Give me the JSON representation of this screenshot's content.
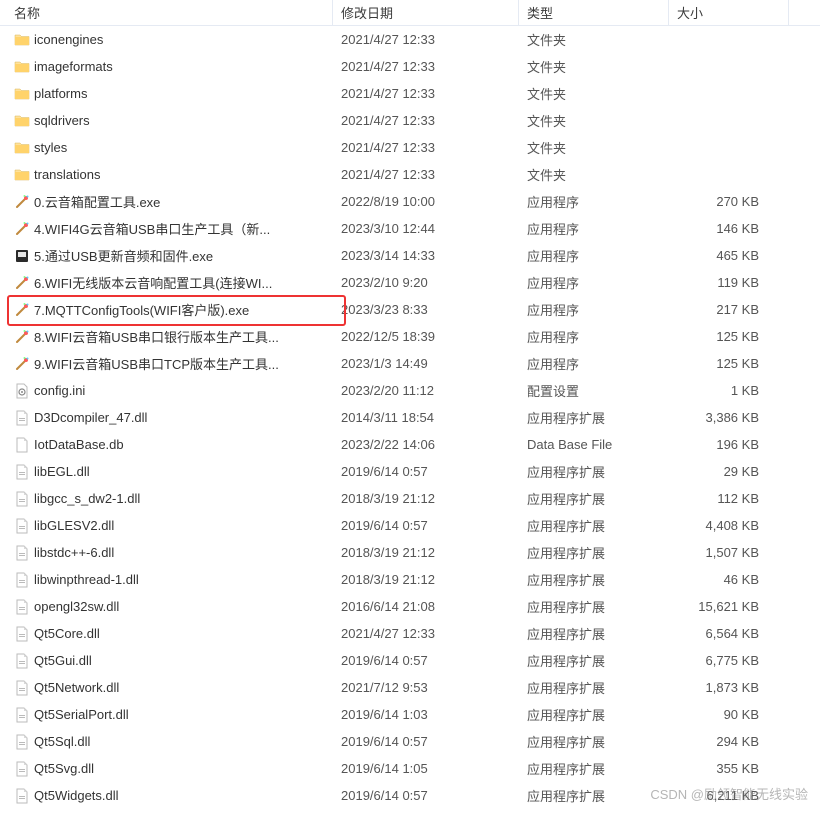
{
  "columns": {
    "name": "名称",
    "date": "修改日期",
    "type": "类型",
    "size": "大小"
  },
  "watermark": "CSDN @励领智能无线实验",
  "files": [
    {
      "icon": "folder",
      "name": "iconengines",
      "date": "2021/4/27 12:33",
      "type": "文件夹",
      "size": ""
    },
    {
      "icon": "folder",
      "name": "imageformats",
      "date": "2021/4/27 12:33",
      "type": "文件夹",
      "size": ""
    },
    {
      "icon": "folder",
      "name": "platforms",
      "date": "2021/4/27 12:33",
      "type": "文件夹",
      "size": ""
    },
    {
      "icon": "folder",
      "name": "sqldrivers",
      "date": "2021/4/27 12:33",
      "type": "文件夹",
      "size": ""
    },
    {
      "icon": "folder",
      "name": "styles",
      "date": "2021/4/27 12:33",
      "type": "文件夹",
      "size": ""
    },
    {
      "icon": "folder",
      "name": "translations",
      "date": "2021/4/27 12:33",
      "type": "文件夹",
      "size": ""
    },
    {
      "icon": "app",
      "name": "0.云音箱配置工具.exe",
      "date": "2022/8/19 10:00",
      "type": "应用程序",
      "size": "270 KB"
    },
    {
      "icon": "app",
      "name": "4.WIFI4G云音箱USB串口生产工具（新...",
      "date": "2023/3/10 12:44",
      "type": "应用程序",
      "size": "146 KB"
    },
    {
      "icon": "app2",
      "name": "5.通过USB更新音频和固件.exe",
      "date": "2023/3/14 14:33",
      "type": "应用程序",
      "size": "465 KB"
    },
    {
      "icon": "app",
      "name": "6.WIFI无线版本云音响配置工具(连接WI...",
      "date": "2023/2/10 9:20",
      "type": "应用程序",
      "size": "119 KB"
    },
    {
      "icon": "app",
      "name": "7.MQTTConfigTools(WIFI客户版).exe",
      "date": "2023/3/23 8:33",
      "type": "应用程序",
      "size": "217 KB",
      "highlight": true
    },
    {
      "icon": "app",
      "name": "8.WIFI云音箱USB串口银行版本生产工具...",
      "date": "2022/12/5 18:39",
      "type": "应用程序",
      "size": "125 KB"
    },
    {
      "icon": "app",
      "name": "9.WIFI云音箱USB串口TCP版本生产工具...",
      "date": "2023/1/3 14:49",
      "type": "应用程序",
      "size": "125 KB"
    },
    {
      "icon": "ini",
      "name": "config.ini",
      "date": "2023/2/20 11:12",
      "type": "配置设置",
      "size": "1 KB"
    },
    {
      "icon": "dll",
      "name": "D3Dcompiler_47.dll",
      "date": "2014/3/11 18:54",
      "type": "应用程序扩展",
      "size": "3,386 KB"
    },
    {
      "icon": "db",
      "name": "IotDataBase.db",
      "date": "2023/2/22 14:06",
      "type": "Data Base File",
      "size": "196 KB"
    },
    {
      "icon": "dll",
      "name": "libEGL.dll",
      "date": "2019/6/14 0:57",
      "type": "应用程序扩展",
      "size": "29 KB"
    },
    {
      "icon": "dll",
      "name": "libgcc_s_dw2-1.dll",
      "date": "2018/3/19 21:12",
      "type": "应用程序扩展",
      "size": "112 KB"
    },
    {
      "icon": "dll",
      "name": "libGLESV2.dll",
      "date": "2019/6/14 0:57",
      "type": "应用程序扩展",
      "size": "4,408 KB"
    },
    {
      "icon": "dll",
      "name": "libstdc++-6.dll",
      "date": "2018/3/19 21:12",
      "type": "应用程序扩展",
      "size": "1,507 KB"
    },
    {
      "icon": "dll",
      "name": "libwinpthread-1.dll",
      "date": "2018/3/19 21:12",
      "type": "应用程序扩展",
      "size": "46 KB"
    },
    {
      "icon": "dll",
      "name": "opengl32sw.dll",
      "date": "2016/6/14 21:08",
      "type": "应用程序扩展",
      "size": "15,621 KB"
    },
    {
      "icon": "dll",
      "name": "Qt5Core.dll",
      "date": "2021/4/27 12:33",
      "type": "应用程序扩展",
      "size": "6,564 KB"
    },
    {
      "icon": "dll",
      "name": "Qt5Gui.dll",
      "date": "2019/6/14 0:57",
      "type": "应用程序扩展",
      "size": "6,775 KB"
    },
    {
      "icon": "dll",
      "name": "Qt5Network.dll",
      "date": "2021/7/12 9:53",
      "type": "应用程序扩展",
      "size": "1,873 KB"
    },
    {
      "icon": "dll",
      "name": "Qt5SerialPort.dll",
      "date": "2019/6/14 1:03",
      "type": "应用程序扩展",
      "size": "90 KB"
    },
    {
      "icon": "dll",
      "name": "Qt5Sql.dll",
      "date": "2019/6/14 0:57",
      "type": "应用程序扩展",
      "size": "294 KB"
    },
    {
      "icon": "dll",
      "name": "Qt5Svg.dll",
      "date": "2019/6/14 1:05",
      "type": "应用程序扩展",
      "size": "355 KB"
    },
    {
      "icon": "dll",
      "name": "Qt5Widgets.dll",
      "date": "2019/6/14 0:57",
      "type": "应用程序扩展",
      "size": "6,211 KB"
    }
  ]
}
